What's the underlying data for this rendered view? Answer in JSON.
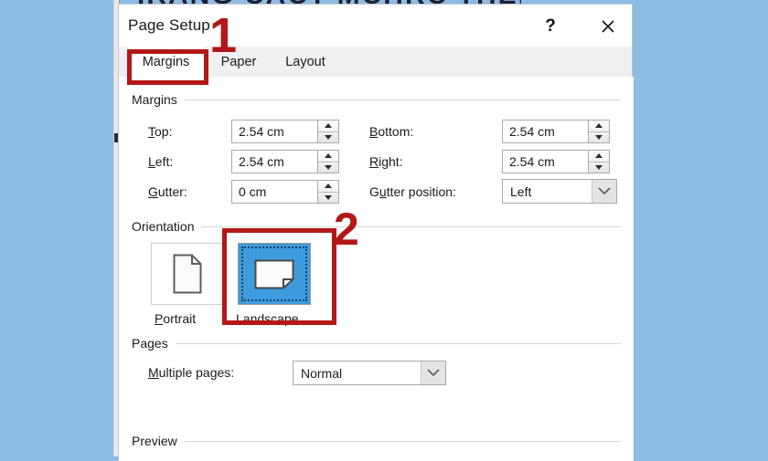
{
  "background": {
    "color": "#8cbce4"
  },
  "cutoff_text": "IRANG CACT MCHRC THEIR BI",
  "dialog": {
    "title": "Page Setup",
    "titlebar_buttons": [
      {
        "name": "help-button",
        "glyph": "?"
      },
      {
        "name": "close-button",
        "glyph": "✕"
      }
    ],
    "tabs": [
      {
        "label": "Margins",
        "active": true
      },
      {
        "label": "Paper",
        "active": false
      },
      {
        "label": "Layout",
        "active": false
      }
    ],
    "groups": {
      "margins": {
        "title": "Margins",
        "fields": [
          {
            "label": "Top:",
            "accel": "T",
            "value": "2.54 cm",
            "type": "spinner"
          },
          {
            "label": "Bottom:",
            "accel": "B",
            "value": "2.54 cm",
            "type": "spinner"
          },
          {
            "label": "Left:",
            "accel": "L",
            "value": "2.54 cm",
            "type": "spinner"
          },
          {
            "label": "Right:",
            "accel": "R",
            "value": "2.54 cm",
            "type": "spinner"
          },
          {
            "label": "Gutter:",
            "accel": "G",
            "value": "0 cm",
            "type": "spinner"
          },
          {
            "label": "Gutter position:",
            "accel": "u",
            "value": "Left",
            "type": "combo"
          }
        ]
      },
      "orientation": {
        "title": "Orientation",
        "options": [
          {
            "label": "Portrait",
            "accel": "P",
            "selected": false,
            "icon": "portrait-page-icon"
          },
          {
            "label": "Landscape",
            "accel": "s",
            "selected": true,
            "icon": "landscape-page-icon"
          }
        ],
        "selection_color": "#3e9bdd"
      },
      "pages": {
        "title": "Pages",
        "multiple_pages_label": "Multiple pages:",
        "multiple_pages_accel": "M",
        "multiple_pages_value": "Normal"
      },
      "preview": {
        "title": "Preview"
      }
    }
  },
  "annotations": {
    "color": "#b31717",
    "markers": [
      {
        "number": "1",
        "target": "margins-tab"
      },
      {
        "number": "2",
        "target": "landscape-orientation"
      }
    ]
  }
}
